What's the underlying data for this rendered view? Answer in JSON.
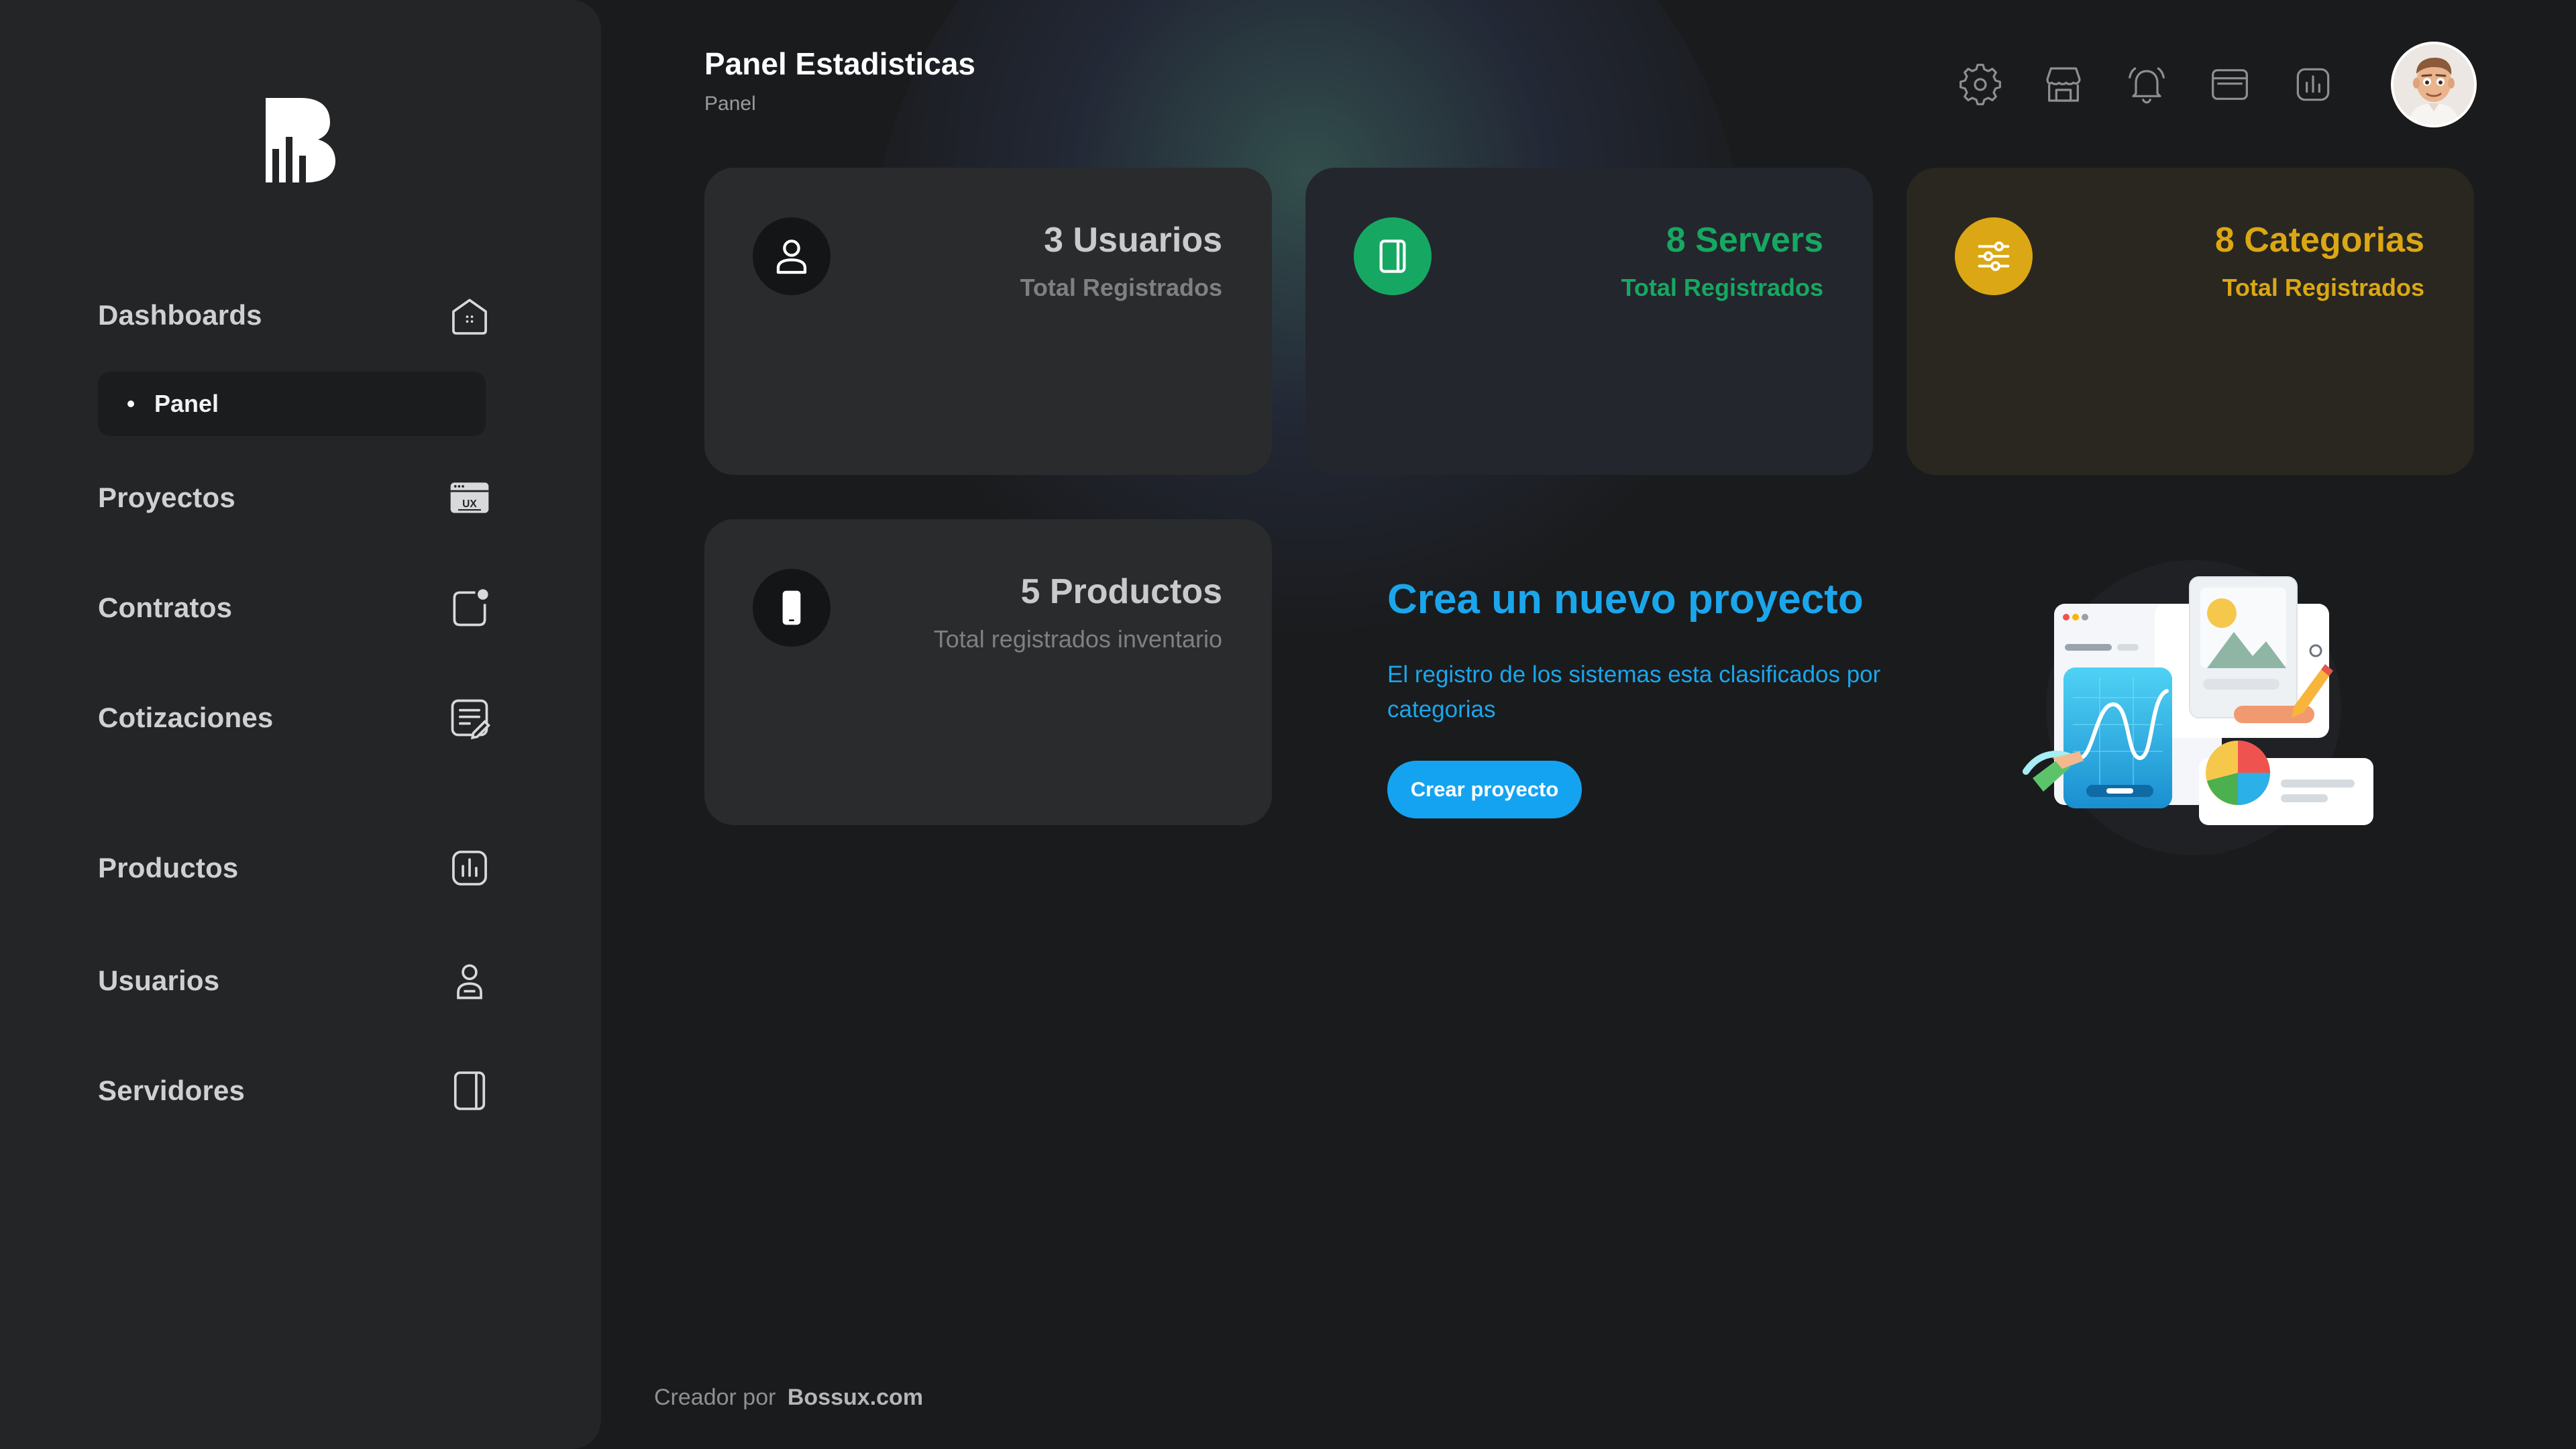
{
  "header": {
    "title": "Panel Estadisticas",
    "breadcrumb": "Panel"
  },
  "topbar": {
    "icons": [
      "settings-icon",
      "store-icon",
      "bell-icon",
      "browser-window-icon",
      "chart-icon"
    ],
    "avatar": "user-avatar"
  },
  "sidebar": {
    "logo": "bossux-logo",
    "items": [
      {
        "label": "Dashboards",
        "icon": "home-icon"
      },
      {
        "label": "Proyectos",
        "icon": "ux-window-icon"
      },
      {
        "label": "Contratos",
        "icon": "contract-badge-icon"
      },
      {
        "label": "Cotizaciones",
        "icon": "quote-document-icon"
      },
      {
        "label": "Productos",
        "icon": "bar-chart-icon"
      },
      {
        "label": "Usuarios",
        "icon": "user-icon"
      },
      {
        "label": "Servidores",
        "icon": "server-icon"
      }
    ],
    "sub_items": [
      {
        "label": "Panel"
      }
    ]
  },
  "cards": {
    "usuarios": {
      "title": "3 Usuarios",
      "subtitle": "Total Registrados",
      "accent": "#ffffff"
    },
    "servers": {
      "title": "8 Servers",
      "subtitle": "Total Registrados",
      "accent": "#16a862"
    },
    "categorias": {
      "title": "8 Categorias",
      "subtitle": "Total Registrados",
      "accent": "#dba714"
    },
    "productos": {
      "title": "5 Productos",
      "subtitle": "Total registrados inventario",
      "accent": "#ffffff"
    }
  },
  "promo": {
    "title": "Crea un nuevo proyecto",
    "text": "El registro de los sistemas esta clasificados por categorias",
    "button": "Crear proyecto",
    "accent": "#14a3f0"
  },
  "footer": {
    "prefix": "Creador por",
    "brand": "Bossux.com"
  }
}
